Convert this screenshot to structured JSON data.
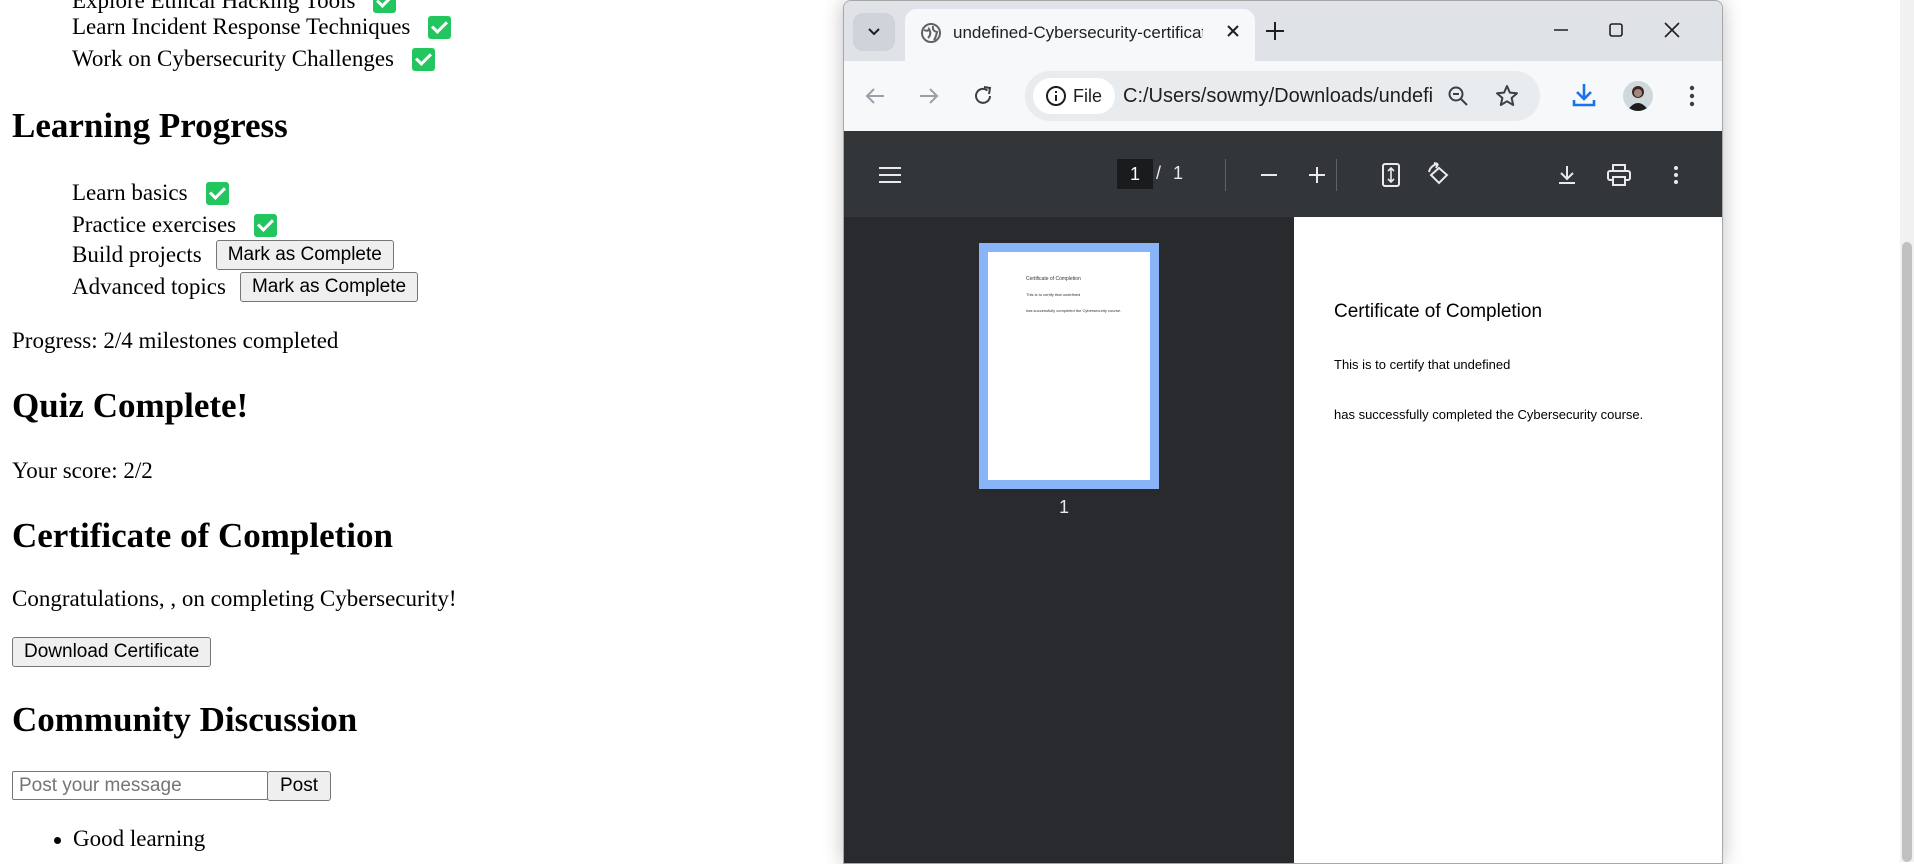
{
  "left_page": {
    "hacking_list": [
      {
        "label": "Explore Ethical Hacking Tools",
        "done": true
      },
      {
        "label": "Learn Incident Response Techniques",
        "done": true
      },
      {
        "label": "Work on Cybersecurity Challenges",
        "done": true
      }
    ],
    "learning_progress": {
      "heading": "Learning Progress",
      "items": [
        {
          "label": "Learn basics",
          "done": true
        },
        {
          "label": "Practice exercises",
          "done": true
        },
        {
          "label": "Build projects",
          "done": false,
          "button": "Mark as Complete"
        },
        {
          "label": "Advanced topics",
          "done": false,
          "button": "Mark as Complete"
        }
      ],
      "progress_text": "Progress: 2/4 milestones completed"
    },
    "quiz": {
      "heading": "Quiz Complete!",
      "score_text": "Your score: 2/2"
    },
    "certificate": {
      "heading": "Certificate of Completion",
      "message": "Congratulations, , on completing Cybersecurity!",
      "download_label": "Download Certificate"
    },
    "community": {
      "heading": "Community Discussion",
      "input_placeholder": "Post your message",
      "post_label": "Post",
      "messages": [
        "Good learning"
      ]
    }
  },
  "browser": {
    "tab_title": "undefined-Cybersecurity-certificate.pdf",
    "address_chip": "File",
    "url": "C:/Users/sowmy/Downloads/undefined-Cybersecurity-certificate.pdf",
    "pdf_toolbar": {
      "current_page": "1",
      "separator": "/",
      "total_pages": "1"
    },
    "thumbnail_number": "1",
    "pdf_content": {
      "title": "Certificate of Completion",
      "line1": "This is to certify that undefined",
      "line2": "has successfully completed the Cybersecurity course."
    }
  },
  "colors": {
    "check_green": "#22c55e",
    "pdf_toolbar_bg": "#323639",
    "viewer_bg": "#282a2d",
    "thumb_border": "#8ab4f8",
    "download_blue": "#1a73e8"
  }
}
